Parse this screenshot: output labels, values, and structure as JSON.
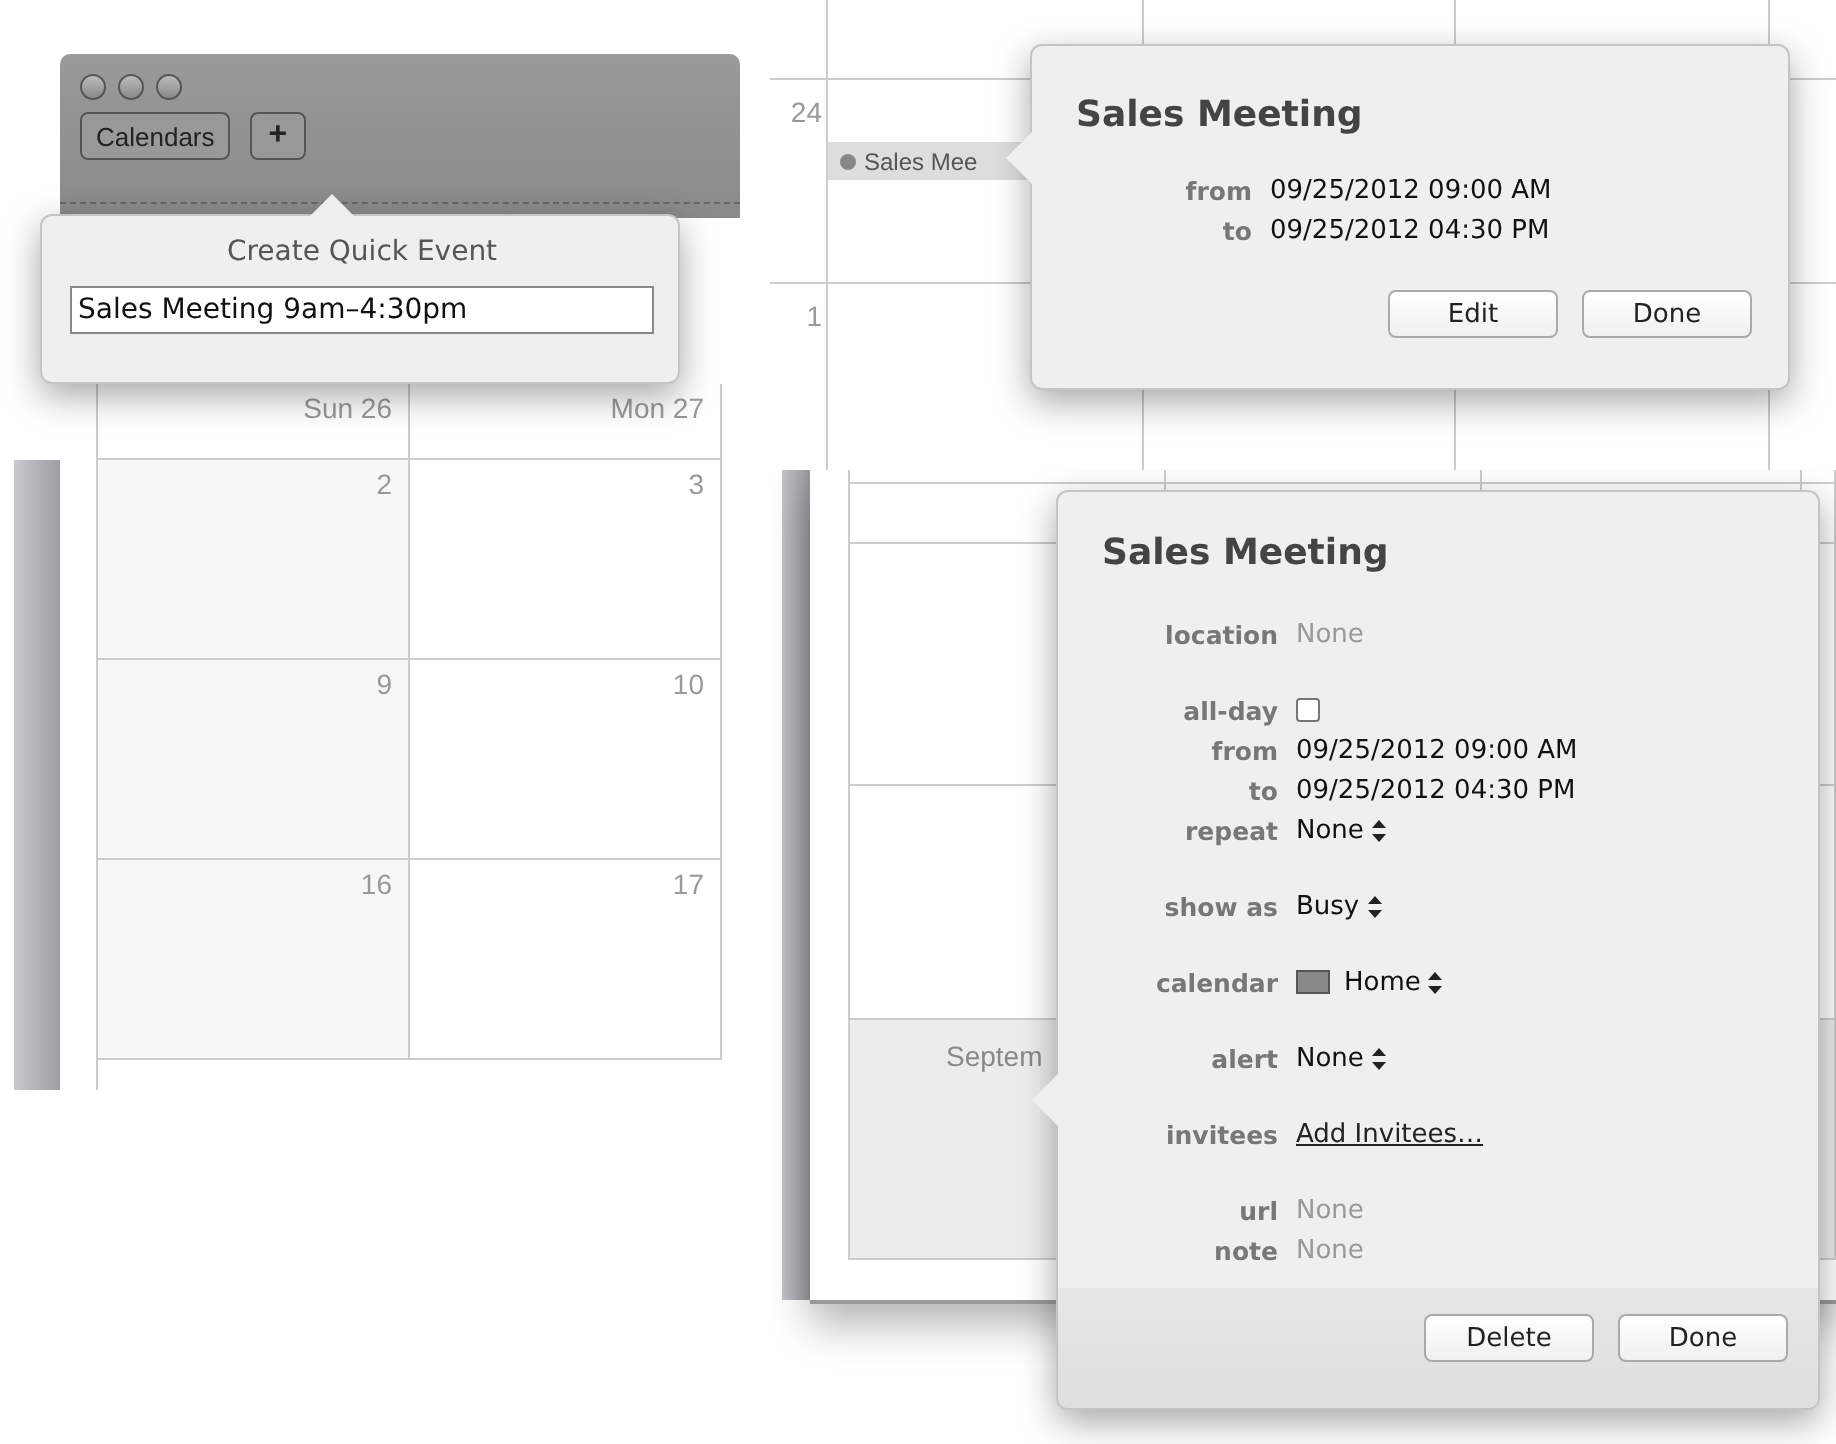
{
  "quick_event_panel": {
    "toolbar": {
      "calendars_button": "Calendars",
      "add_button": "+"
    },
    "popover": {
      "title": "Create Quick Event",
      "value": "Sales Meeting 9am–4:30pm"
    },
    "grid": {
      "columns": [
        "Sun 26",
        "Mon 27"
      ],
      "rows": [
        [
          "2",
          "3"
        ],
        [
          "9",
          "10"
        ],
        [
          "16",
          "17"
        ]
      ]
    }
  },
  "event_summary_panel": {
    "day_numbers": [
      "24",
      "1"
    ],
    "event_chip": "Sales Mee",
    "popover": {
      "title": "Sales Meeting",
      "fields": [
        {
          "label": "from",
          "value": "09/25/2012 09:00 AM"
        },
        {
          "label": "to",
          "value": "09/25/2012 04:30 PM"
        }
      ],
      "buttons": [
        "Edit",
        "Done"
      ]
    }
  },
  "event_detail_panel": {
    "date_label": "Septem",
    "popover": {
      "title": "Sales Meeting",
      "groups": [
        [
          {
            "kind": "empty",
            "label": "location",
            "placeholder": "None"
          }
        ],
        [
          {
            "kind": "checkbox",
            "label": "all-day",
            "checked": false
          },
          {
            "kind": "text",
            "label": "from",
            "value": "09/25/2012 09:00 AM"
          },
          {
            "kind": "text",
            "label": "to",
            "value": "09/25/2012 04:30 PM"
          },
          {
            "kind": "popup",
            "label": "repeat",
            "value": "None"
          }
        ],
        [
          {
            "kind": "popup",
            "label": "show as",
            "value": "Busy"
          }
        ],
        [
          {
            "kind": "calendar",
            "label": "calendar",
            "value": "Home"
          }
        ],
        [
          {
            "kind": "popup",
            "label": "alert",
            "value": "None"
          }
        ],
        [
          {
            "kind": "link",
            "label": "invitees",
            "value": "Add Invitees…"
          }
        ],
        [
          {
            "kind": "empty",
            "label": "url",
            "placeholder": "None"
          },
          {
            "kind": "empty",
            "label": "note",
            "placeholder": "None"
          }
        ]
      ],
      "buttons": [
        "Delete",
        "Done"
      ]
    }
  }
}
